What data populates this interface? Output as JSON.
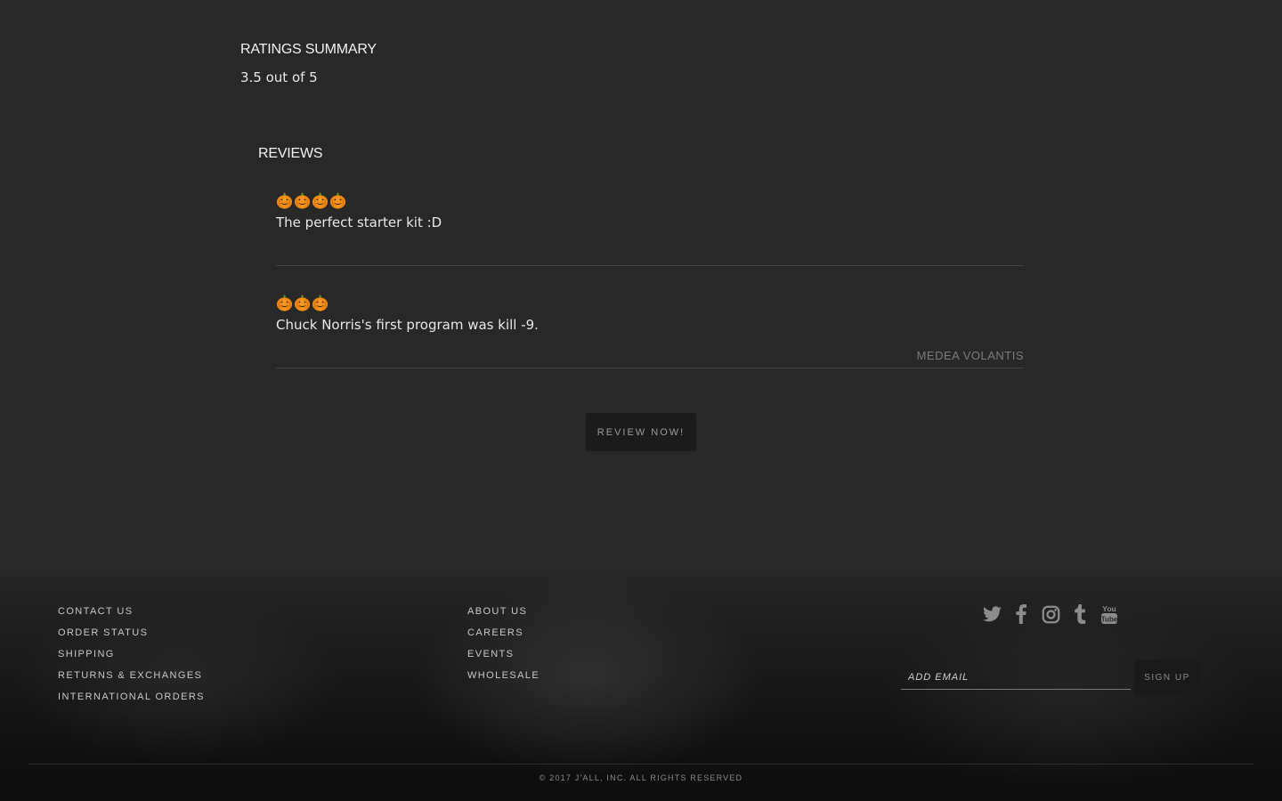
{
  "ratings_summary": {
    "title": "RATINGS SUMMARY",
    "value": "3.5 out of 5"
  },
  "reviews": {
    "title": "REVIEWS",
    "items": [
      {
        "rating": 4,
        "max_rating": 5,
        "rating_icon": "pumpkin-icon",
        "text": "The perfect starter kit :D",
        "author": ""
      },
      {
        "rating": 3,
        "max_rating": 5,
        "rating_icon": "pumpkin-icon",
        "text": "Chuck Norris's first program was kill -9.",
        "author": "MEDEA VOLANTIS"
      }
    ],
    "review_button_label": "REVIEW NOW!"
  },
  "footer": {
    "links_col_1": [
      "CONTACT US",
      "ORDER STATUS",
      "SHIPPING",
      "RETURNS & EXCHANGES",
      "INTERNATIONAL ORDERS"
    ],
    "links_col_2": [
      "ABOUT US",
      "CAREERS",
      "EVENTS",
      "WHOLESALE"
    ],
    "social_icons": [
      "twitter-icon",
      "facebook-icon",
      "instagram-icon",
      "tumblr-icon",
      "youtube-icon"
    ],
    "email_placeholder": "ADD EMAIL",
    "signup_label": "SIGN UP",
    "copyright": "© 2017 J'ALL, INC. ALL RIGHTS RESERVED"
  },
  "colors": {
    "background": "#282828",
    "pumpkin": "#f08a12",
    "icon_gray": "#8c8c8c"
  }
}
